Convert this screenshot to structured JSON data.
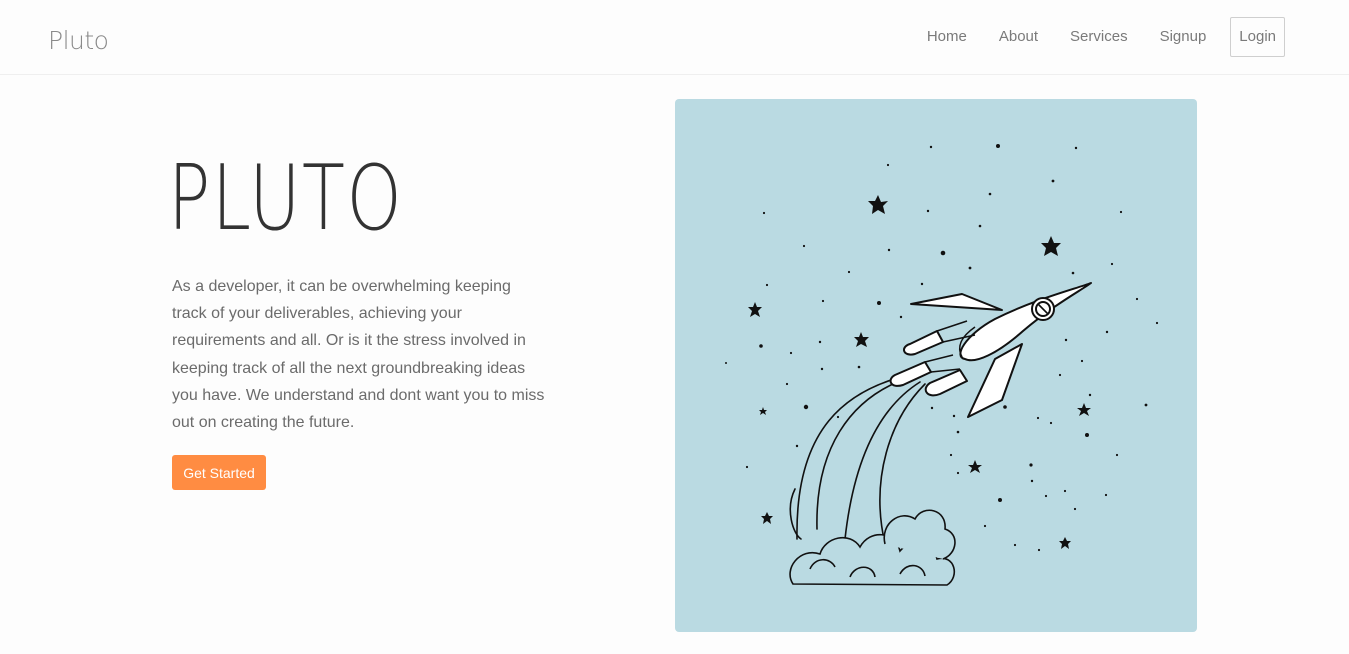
{
  "navbar": {
    "brand": "Pluto",
    "links": [
      {
        "label": "Home"
      },
      {
        "label": "About"
      },
      {
        "label": "Services"
      },
      {
        "label": "Signup"
      }
    ],
    "login_label": "Login"
  },
  "hero": {
    "title": "PLUTO",
    "description": "As a developer, it can be overwhelming keeping track of your deliverables, achieving your requirements and all. Or is it the stress involved in keeping track of all the next groundbreaking ideas you have. We understand and dont want you to miss out on creating the future.",
    "cta_label": "Get Started"
  },
  "illustration": {
    "icon": "rocket-launch-icon",
    "background_color": "#badae2"
  },
  "colors": {
    "accent": "#ff8c42",
    "title": "#333333",
    "body_text": "#6b6b6b"
  }
}
